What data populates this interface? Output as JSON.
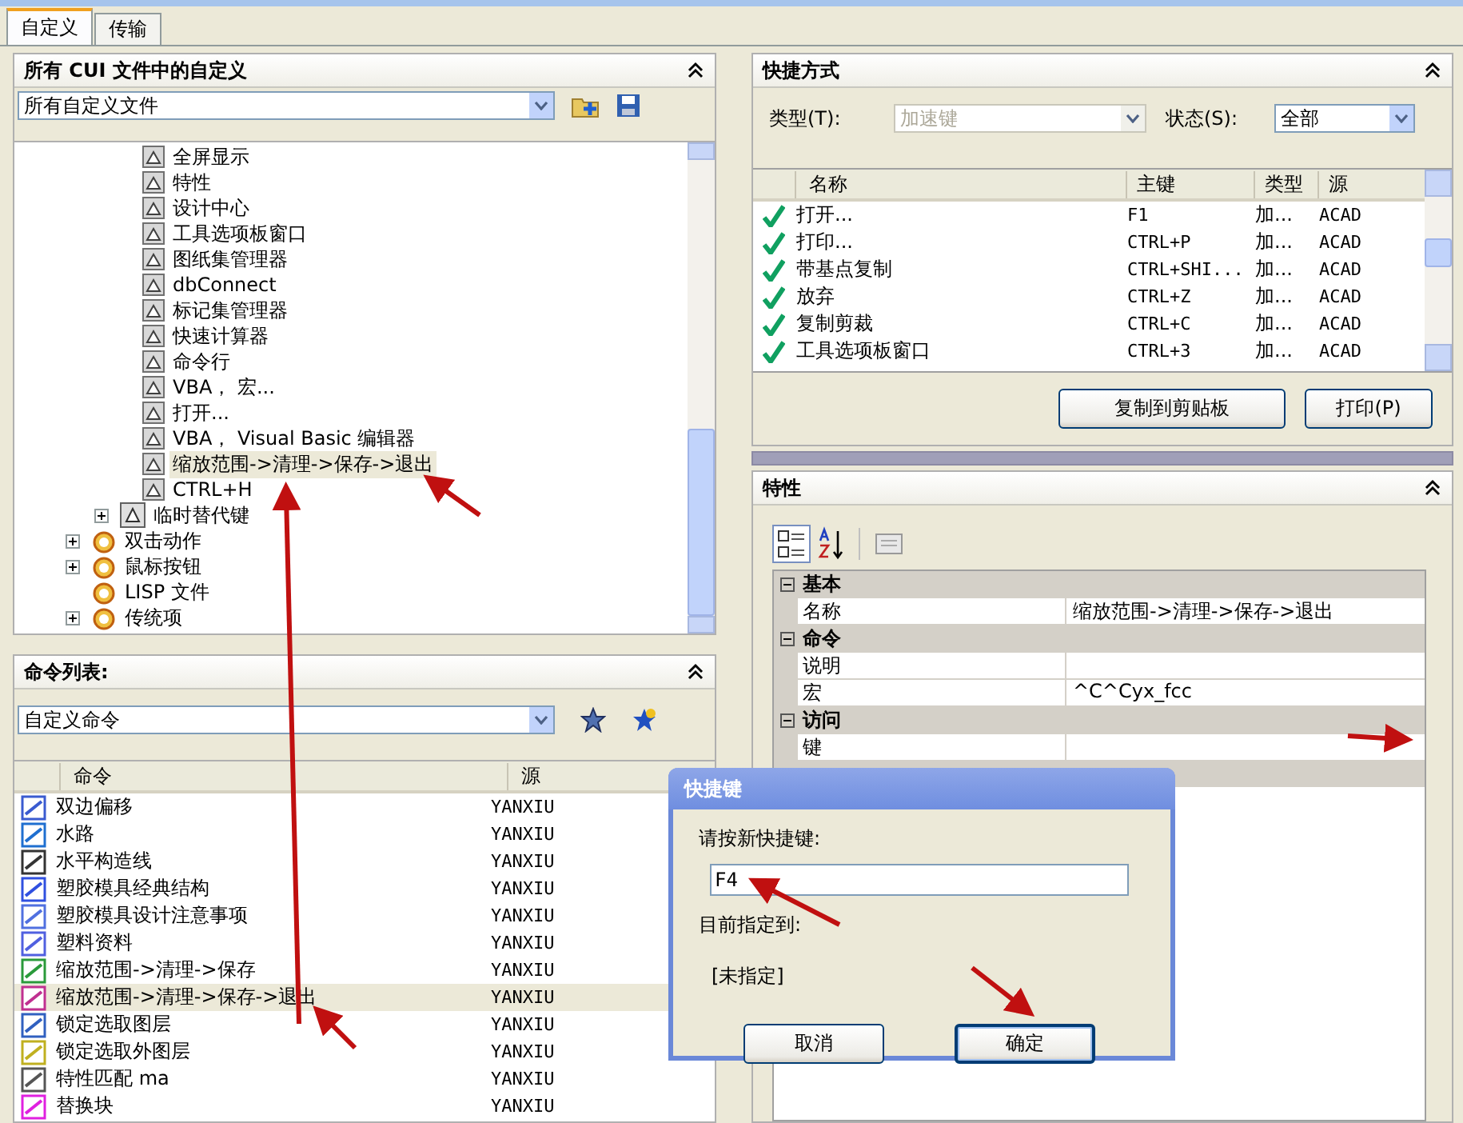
{
  "tabs": [
    {
      "label": "自定义",
      "selected": true
    },
    {
      "label": "传输",
      "selected": false
    }
  ],
  "customizations": {
    "title": "所有 CUI 文件中的自定义",
    "file_select": "所有自定义文件",
    "tree": [
      {
        "children": [
          {
            "children": [
              {
                "label": "全屏显示",
                "selected": false
              },
              {
                "label": "特性",
                "selected": false
              },
              {
                "label": "设计中心",
                "selected": false
              },
              {
                "label": "工具选项板窗口",
                "selected": false
              },
              {
                "label": "图纸集管理器",
                "selected": false
              },
              {
                "label": "dbConnect",
                "selected": false
              },
              {
                "label": "标记集管理器",
                "selected": false
              },
              {
                "label": "快速计算器",
                "selected": false
              },
              {
                "label": "命令行",
                "selected": false
              },
              {
                "label": "VBA， 宏...",
                "selected": false
              },
              {
                "label": "打开...",
                "selected": false
              },
              {
                "label": "VBA， Visual Basic 编辑器",
                "selected": false
              },
              {
                "label": "缩放范围->清理->保存->退出",
                "selected": true
              },
              {
                "label": "CTRL+H",
                "selected": false
              }
            ]
          },
          {
            "label": "临时替代键",
            "kind": "group",
            "expanded": false
          }
        ]
      },
      {
        "label": "双击动作",
        "kind": "group",
        "expanded": false
      },
      {
        "label": "鼠标按钮",
        "kind": "group",
        "expanded": false
      },
      {
        "label": "LISP 文件",
        "kind": "leaf"
      },
      {
        "label": "传统项",
        "kind": "group",
        "expanded": false
      }
    ]
  },
  "command_list": {
    "title": "命令列表:",
    "filter": "自定义命令",
    "columns": [
      "命令",
      "源"
    ],
    "rows": [
      {
        "command": "双边偏移",
        "source": "YANXIU",
        "selected": false
      },
      {
        "command": "水路",
        "source": "YANXIU",
        "selected": false
      },
      {
        "command": "水平构造线",
        "source": "YANXIU",
        "selected": false
      },
      {
        "command": "塑胶模具经典结构",
        "source": "YANXIU",
        "selected": false
      },
      {
        "command": "塑胶模具设计注意事项",
        "source": "YANXIU",
        "selected": false
      },
      {
        "command": "塑料资料",
        "source": "YANXIU",
        "selected": false
      },
      {
        "command": "缩放范围->清理->保存",
        "source": "YANXIU",
        "selected": false
      },
      {
        "command": "缩放范围->清理->保存->退出",
        "source": "YANXIU",
        "selected": true
      },
      {
        "command": "锁定选取图层",
        "source": "YANXIU",
        "selected": false
      },
      {
        "command": "锁定选取外图层",
        "source": "YANXIU",
        "selected": false
      },
      {
        "command": "特性匹配 ma",
        "source": "YANXIU",
        "selected": false
      },
      {
        "command": "替换块",
        "source": "YANXIU",
        "selected": false
      }
    ]
  },
  "shortcuts": {
    "title": "快捷方式",
    "type_label": "类型(T):",
    "type_value": "加速键",
    "type_disabled": true,
    "status_label": "状态(S):",
    "status_value": "全部",
    "columns": [
      "名称",
      "主键",
      "类型",
      "源"
    ],
    "rows": [
      {
        "name": "打开...",
        "key": "F1",
        "type": "加...",
        "source": "ACAD"
      },
      {
        "name": "打印...",
        "key": "CTRL+P",
        "type": "加...",
        "source": "ACAD"
      },
      {
        "name": "带基点复制",
        "key": "CTRL+SHI...",
        "type": "加...",
        "source": "ACAD"
      },
      {
        "name": "放弃",
        "key": "CTRL+Z",
        "type": "加...",
        "source": "ACAD"
      },
      {
        "name": "复制剪裁",
        "key": "CTRL+C",
        "type": "加...",
        "source": "ACAD"
      },
      {
        "name": "工具选项板窗口",
        "key": "CTRL+3",
        "type": "加...",
        "source": "ACAD"
      }
    ],
    "buttons": [
      "复制到剪贴板",
      "打印(P)"
    ]
  },
  "properties": {
    "title": "特性",
    "categories": [
      {
        "label": "基本",
        "expanded": true,
        "rows": [
          {
            "name": "名称",
            "value": "缩放范围->清理->保存->退出"
          }
        ]
      },
      {
        "label": "命令",
        "expanded": true,
        "rows": [
          {
            "name": "说明"
          },
          {
            "name": "宏",
            "value": "^C^Cyx_fcc"
          }
        ]
      },
      {
        "label": "访问",
        "expanded": true,
        "rows": [
          {
            "name": "键"
          }
        ]
      }
    ]
  },
  "dialog": {
    "title": "快捷键",
    "prompt": "请按新快捷键:",
    "value": "F4",
    "assigned_label": "目前指定到:",
    "assigned_value": "[未指定]",
    "buttons": [
      {
        "label": "取消",
        "default": false
      },
      {
        "label": "确定",
        "default": true
      }
    ]
  }
}
